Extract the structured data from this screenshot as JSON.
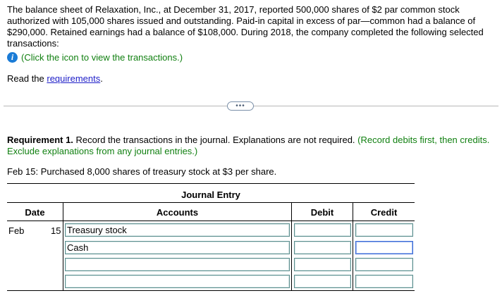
{
  "intro": {
    "text": "The balance sheet of Relaxation, Inc., at December 31, 2017, reported 500,000 shares of $2 par common stock authorized with 105,000 shares issued and outstanding. Paid-in capital in excess of par—common had a balance of $290,000. Retained earnings had a balance of $108,000. During 2018, the company completed the following selected transactions:"
  },
  "info": {
    "icon": "info-icon",
    "text": "(Click the icon to view the transactions.)"
  },
  "read": {
    "prefix": "Read the ",
    "link": "requirements",
    "suffix": "."
  },
  "expander": {
    "label": "•••"
  },
  "requirement": {
    "bold": "Requirement 1.",
    "text": " Record the transactions in the journal. Explanations are not required.",
    "note": "(Record debits first, then credits. Exclude explanations from any journal entries.)"
  },
  "transaction": "Feb 15: Purchased 8,000 shares of treasury stock at $3 per share.",
  "journal": {
    "title": "Journal Entry",
    "headers": {
      "date": "Date",
      "accounts": "Accounts",
      "debit": "Debit",
      "credit": "Credit"
    },
    "month": "Feb",
    "day": "15",
    "rows": [
      {
        "account": "Treasury stock",
        "debit": "",
        "credit": ""
      },
      {
        "account": "Cash",
        "debit": "",
        "credit": ""
      },
      {
        "account": "",
        "debit": "",
        "credit": ""
      },
      {
        "account": "",
        "debit": "",
        "credit": ""
      }
    ]
  }
}
